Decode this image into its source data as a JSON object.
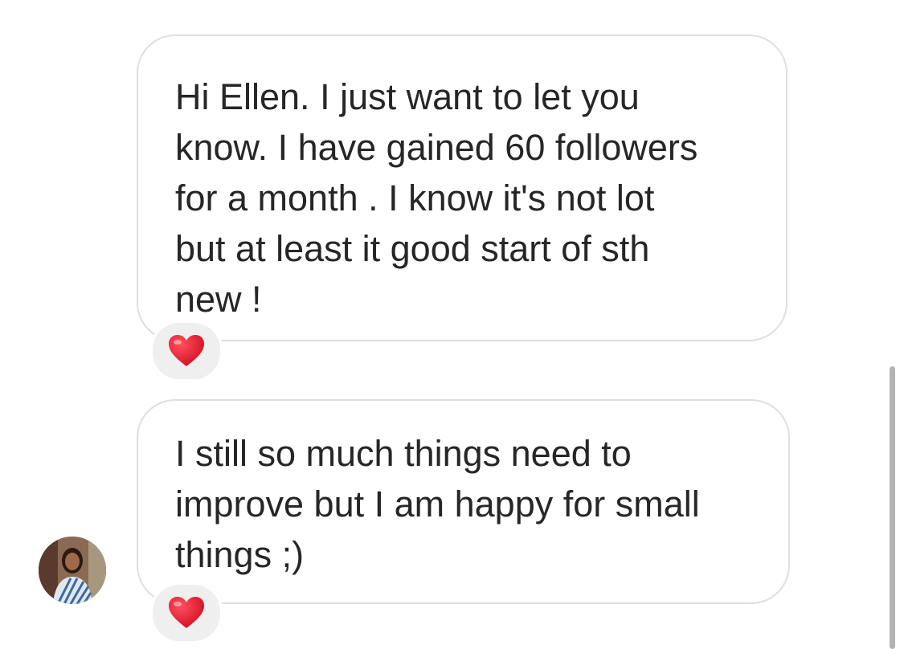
{
  "messages": [
    {
      "text": "Hi Ellen. I just want to let you\nknow. I have gained 60 followers\nfor a month . I know it's not lot\nbut at least it good start of sth\nnew !",
      "reaction": "heart-icon"
    },
    {
      "text": "I still so much things need to\nimprove but I am happy for small\nthings ;)",
      "reaction": "heart-icon"
    }
  ],
  "colors": {
    "bubble_border": "#dfdfdf",
    "text": "#262626",
    "reaction_bg": "#efefef",
    "heart": "#e0162b",
    "scrollbar": "#b3b3b3"
  }
}
